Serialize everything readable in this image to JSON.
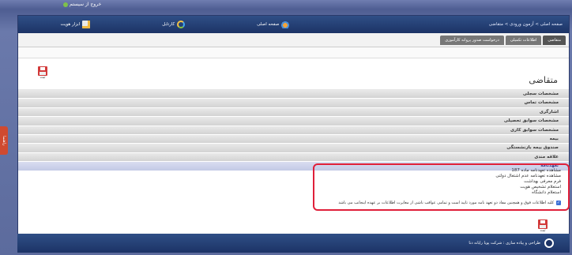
{
  "top": {
    "exit_label": "خروج از سیستم"
  },
  "side_tab_label": "راهنما",
  "header": {
    "breadcrumb": "صفحه اصلی > آزمون ورودی > متقاضی",
    "links": [
      {
        "label": "صفحه اصلی",
        "icon": "home-icon"
      },
      {
        "label": "کارتابل",
        "icon": "cartable-icon"
      },
      {
        "label": "ابزار هویت",
        "icon": "tools-icon"
      }
    ]
  },
  "tabs": [
    "متقاضی",
    "اطلاعات تکمیلی",
    "درخواست صدور پروانه کارآموزی"
  ],
  "page_title": "متقاضی",
  "update_label": "ثبت",
  "sections": [
    "مشخصات سجلی",
    "مشخصات تماس",
    "اشارگری",
    "مشخصات سوابق تحصیلی",
    "مشخصات سوابق کاری",
    "بیمه",
    "صندوق بیمه بازنشستگی",
    "علاقه مندی",
    "تعهدنامه"
  ],
  "commitments": [
    "مشاهده تعهدنامه ماده 187",
    "مشاهده تعهدنامه عدم اشتغال دولتی",
    "فرم معرفی بهداشت",
    "استعلام تشخیص هویت",
    "استعلام دانشگاه"
  ],
  "agreement_text": "کلیه اطلاعات فوق و همچنین مفاد دو تعهد نامه مورد تایید است و تمامی عواقب ناشی از مغایرت اطلاعات بر عهده اینجانب می باشد",
  "agreement_checked": true,
  "footer_text": "طراحی و پیاده سازی : شرکت پویا رایانه دنا",
  "colors": {
    "header": "#1c3366",
    "highlight_box": "#e0203a",
    "open_section": "#3a3f8a"
  }
}
